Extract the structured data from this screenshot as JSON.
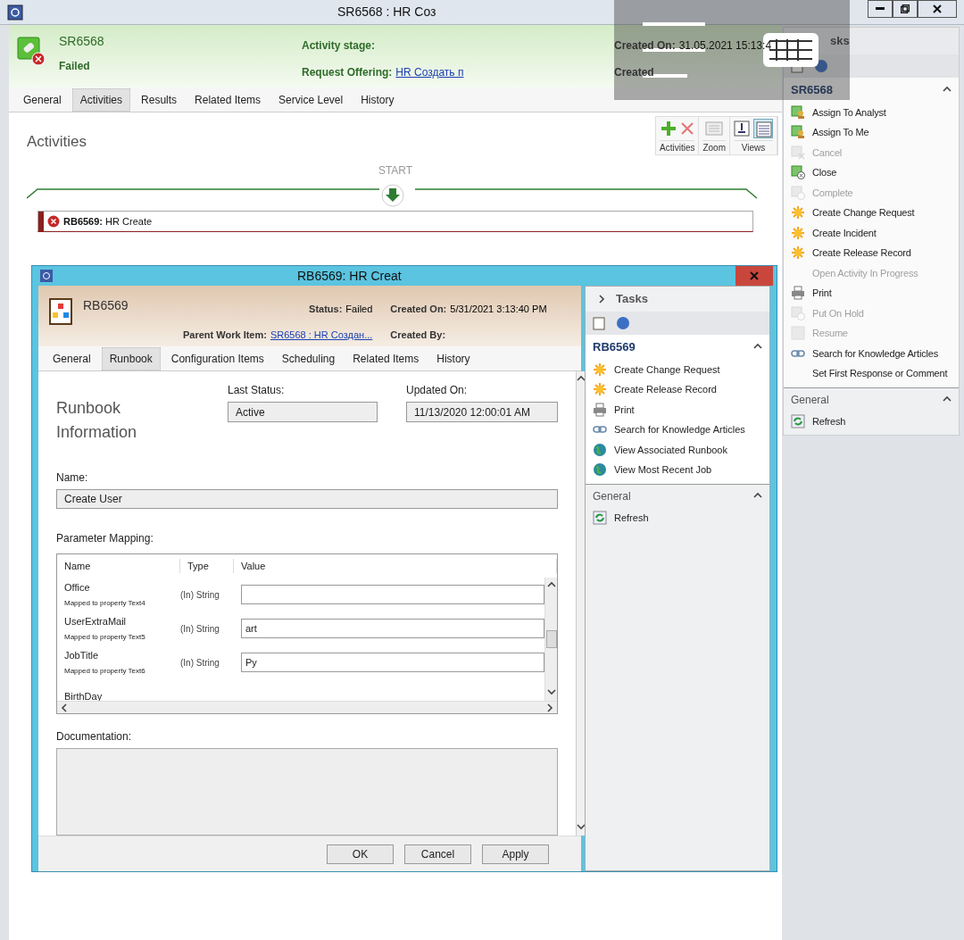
{
  "window": {
    "title": "SR6568 : HR Соз"
  },
  "header": {
    "id": "SR6568",
    "status": "Failed",
    "fields": [
      {
        "label": "Activity stage:"
      },
      {
        "label": "Request Offering:",
        "value": "HR Создать п",
        "link": true
      }
    ],
    "created": [
      {
        "label": "Created On:",
        "value": "31.05.2021 15:13:4"
      },
      {
        "label": "Created"
      }
    ]
  },
  "tabs": [
    {
      "label": "General",
      "selected": false
    },
    {
      "label": "Activities",
      "selected": true
    },
    {
      "label": "Results",
      "selected": false
    },
    {
      "label": "Related Items",
      "selected": false
    },
    {
      "label": "Service Level",
      "selected": false
    },
    {
      "label": "History",
      "selected": false
    }
  ],
  "section_title": "Activities",
  "toolbar": [
    {
      "label": "Activities",
      "kind": "edit"
    },
    {
      "label": "Zoom",
      "kind": "zoom"
    },
    {
      "label": "Views",
      "kind": "views"
    }
  ],
  "start_label": "START",
  "activity": {
    "id": "RB6569:",
    "title": "HR Create",
    "failed": true
  },
  "tasks": {
    "title": "sks",
    "section": "SR6568",
    "items": [
      {
        "label": "Assign To Analyst",
        "kind": "assign",
        "disabled": false
      },
      {
        "label": "Assign To Me",
        "kind": "assign",
        "disabled": false
      },
      {
        "label": "Cancel",
        "kind": "cancel",
        "disabled": true
      },
      {
        "label": "Close",
        "kind": "close",
        "disabled": false
      },
      {
        "label": "Complete",
        "kind": "complete",
        "disabled": true
      },
      {
        "label": "Create Change Request",
        "kind": "create",
        "disabled": false
      },
      {
        "label": "Create Incident",
        "kind": "create",
        "disabled": false
      },
      {
        "label": "Create Release Record",
        "kind": "create",
        "disabled": false
      },
      {
        "label": "Open Activity In Progress",
        "kind": "plain",
        "disabled": true
      },
      {
        "label": "Print",
        "kind": "print",
        "disabled": false
      },
      {
        "label": "Put On Hold",
        "kind": "hold",
        "disabled": true
      },
      {
        "label": "Resume",
        "kind": "resume",
        "disabled": true
      },
      {
        "label": "Search for Knowledge Articles",
        "kind": "search",
        "disabled": false
      },
      {
        "label": "Set First Response or Comment",
        "kind": "plain",
        "disabled": false
      }
    ],
    "general": "General",
    "general_items": [
      {
        "label": "Refresh",
        "kind": "refresh",
        "disabled": false
      }
    ]
  },
  "dialog": {
    "title": "RB6569: HR Creat",
    "id": "RB6569",
    "status": {
      "label": "Status:",
      "value": "Failed"
    },
    "created_on": {
      "label": "Created On:",
      "value": "5/31/2021 3:13:40 PM"
    },
    "parent": {
      "label": "Parent Work Item:",
      "value": "SR6568 : HR Создан..."
    },
    "created_by": {
      "label": "Created By:"
    },
    "tabs": [
      {
        "label": "General",
        "selected": false
      },
      {
        "label": "Runbook",
        "selected": true
      },
      {
        "label": "Configuration Items",
        "selected": false
      },
      {
        "label": "Scheduling",
        "selected": false
      },
      {
        "label": "Related Items",
        "selected": false
      },
      {
        "label": "History",
        "selected": false
      }
    ],
    "heading": "Runbook Information",
    "last_status": {
      "label": "Last Status:",
      "value": "Active"
    },
    "updated_on": {
      "label": "Updated On:",
      "value": "11/13/2020 12:00:01 AM"
    },
    "name": {
      "label": "Name:",
      "value": "Create User"
    },
    "mapping_label": "Parameter Mapping:",
    "columns": [
      "Name",
      "Type",
      "Value"
    ],
    "rows": [
      {
        "name": "Office",
        "mapped": "Mapped to property Text4",
        "type": "(In) String",
        "value": ""
      },
      {
        "name": "UserExtraMail",
        "mapped": "Mapped to property Text5",
        "type": "(In) String",
        "value": "art"
      },
      {
        "name": "JobTitle",
        "mapped": "Mapped to property Text6",
        "type": "(In) String",
        "value": "Py"
      },
      {
        "name": "BirthDay"
      }
    ],
    "documentation_label": "Documentation:",
    "buttons": [
      "OK",
      "Cancel",
      "Apply"
    ],
    "tasks": {
      "title": "Tasks",
      "section": "RB6569",
      "items": [
        {
          "label": "Create Change Request",
          "kind": "create",
          "disabled": false
        },
        {
          "label": "Create Release Record",
          "kind": "create",
          "disabled": false
        },
        {
          "label": "Print",
          "kind": "print",
          "disabled": false
        },
        {
          "label": "Search for Knowledge Articles",
          "kind": "search",
          "disabled": false
        },
        {
          "label": "View Associated Runbook",
          "kind": "runbook",
          "disabled": false
        },
        {
          "label": "View Most Recent Job",
          "kind": "runbook",
          "disabled": false
        }
      ],
      "general": "General",
      "general_items": [
        {
          "label": "Refresh",
          "kind": "refresh",
          "disabled": false
        }
      ]
    }
  }
}
